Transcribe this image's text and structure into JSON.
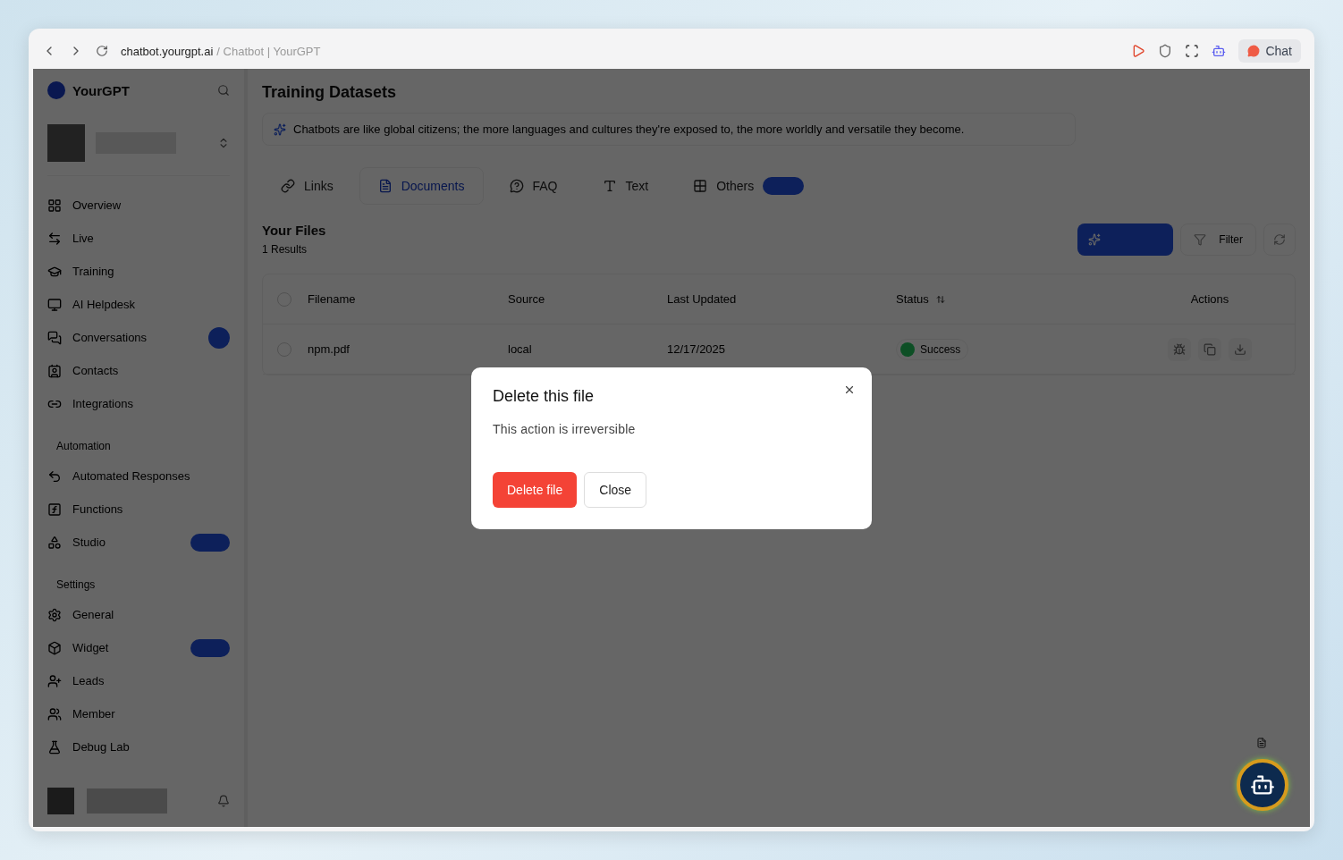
{
  "browser": {
    "url": "chatbot.yourgpt.ai",
    "page_title": "/ Chatbot | YourGPT",
    "chat_button": "Chat"
  },
  "sidebar": {
    "brand": "YourGPT",
    "sections": [
      {
        "items": [
          {
            "kind": "overview",
            "label": "Overview",
            "dot": false,
            "badge": false
          },
          {
            "kind": "live",
            "label": "Live",
            "dot": false,
            "badge": false
          },
          {
            "kind": "training",
            "label": "Training",
            "dot": false,
            "badge": false
          },
          {
            "kind": "helpdesk",
            "label": "AI Helpdesk",
            "dot": false,
            "badge": false
          },
          {
            "kind": "conversations",
            "label": "Conversations",
            "dot": true,
            "badge": false
          },
          {
            "kind": "contacts",
            "label": "Contacts",
            "dot": false,
            "badge": false
          },
          {
            "kind": "integrations",
            "label": "Integrations",
            "dot": false,
            "badge": false
          }
        ]
      },
      {
        "heading": "Automation",
        "items": [
          {
            "kind": "responses",
            "label": "Automated Responses",
            "dot": false,
            "badge": false
          },
          {
            "kind": "functions",
            "label": "Functions",
            "dot": false,
            "badge": false
          },
          {
            "kind": "studio",
            "label": "Studio",
            "dot": false,
            "badge": true
          }
        ]
      },
      {
        "heading": "Settings",
        "items": [
          {
            "kind": "general",
            "label": "General",
            "dot": false,
            "badge": false
          },
          {
            "kind": "widget",
            "label": "Widget",
            "dot": false,
            "badge": true
          },
          {
            "kind": "leads",
            "label": "Leads",
            "dot": false,
            "badge": false
          },
          {
            "kind": "member",
            "label": "Member",
            "dot": false,
            "badge": false
          },
          {
            "kind": "debug",
            "label": "Debug Lab",
            "dot": false,
            "badge": false
          }
        ]
      }
    ]
  },
  "main": {
    "title": "Training Datasets",
    "tip": "Chatbots are like global citizens; the more languages and cultures they're exposed to, the more worldly and versatile they become.",
    "tabs": [
      {
        "kind": "links",
        "label": "Links",
        "selected": false,
        "badge": false
      },
      {
        "kind": "documents",
        "label": "Documents",
        "selected": true,
        "badge": false
      },
      {
        "kind": "faq",
        "label": "FAQ",
        "selected": false,
        "badge": false
      },
      {
        "kind": "text",
        "label": "Text",
        "selected": false,
        "badge": false
      },
      {
        "kind": "others",
        "label": "Others",
        "selected": false,
        "badge": true
      }
    ],
    "files_heading": "Your Files",
    "results": "1 Results",
    "filter_button": "Filter",
    "table": {
      "columns": [
        "Filename",
        "Source",
        "Last Updated",
        "Status",
        "Actions"
      ],
      "all_checked": false,
      "rows": [
        {
          "filename": "npm.pdf",
          "source": "local",
          "updated": "12/17/2025",
          "status": "Success",
          "checked": false
        }
      ]
    }
  },
  "dialog": {
    "title": "Delete this file",
    "message": "This action is irreversible",
    "confirm": "Delete file",
    "cancel": "Close"
  }
}
